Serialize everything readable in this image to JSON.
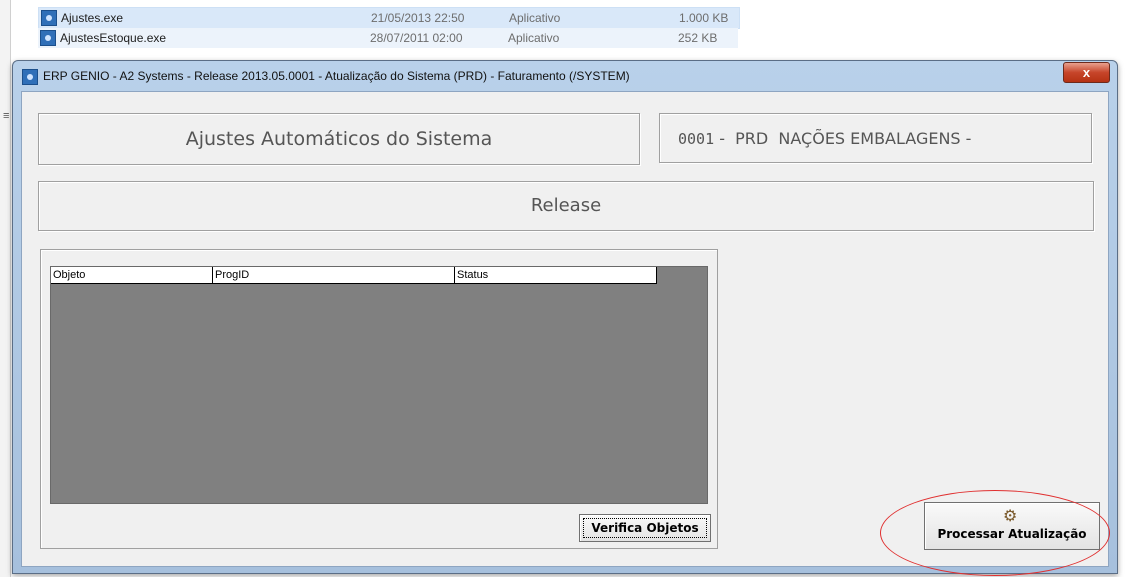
{
  "background_files": [
    {
      "name": "Ajustes.exe",
      "date": "21/05/2013 22:50",
      "type": "Aplicativo",
      "size": "1.000 KB"
    },
    {
      "name": "AjustesEstoque.exe",
      "date": "28/07/2011 02:00",
      "type": "Aplicativo",
      "size": "252 KB"
    }
  ],
  "window": {
    "title": "ERP GENIO - A2 Systems - Release 2013.05.0001 - Atualização do Sistema (PRD) - Faturamento (/SYSTEM)",
    "close_glyph": "x"
  },
  "header": {
    "title": "Ajustes Automáticos do Sistema",
    "company_code": "0001",
    "company_text": " -  PRD  NAÇÕES EMBALAGENS -"
  },
  "release_label": "Release",
  "objects_list": {
    "columns": [
      "Objeto",
      "ProgID",
      "Status"
    ],
    "rows": []
  },
  "buttons": {
    "verify": "Verifica Objetos",
    "process": "Processar Atualização"
  },
  "colors": {
    "annotation_circle": "#e03030",
    "list_background": "#808080",
    "window_frame": "#b9d1ea"
  },
  "icons": [
    "app-exe-icon",
    "gear-icon",
    "close-icon"
  ]
}
